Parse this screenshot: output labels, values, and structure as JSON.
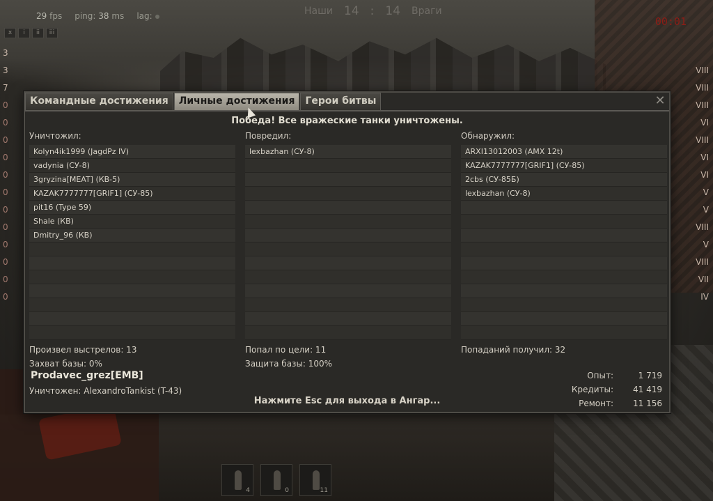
{
  "hud": {
    "fps_value": "29",
    "fps_label": "fps",
    "ping_label": "ping:",
    "ping_value": "38",
    "ping_unit": "ms",
    "lag_label": "lag:",
    "team_ours": "Наши",
    "team_ours_score": "14",
    "score_separator": ":",
    "team_enemy_score": "14",
    "team_enemy": "Враги",
    "timer": "00:01",
    "view_buttons": [
      "x",
      "i",
      "ii",
      "iii"
    ]
  },
  "team_left_rows": [
    "3",
    "3",
    "7",
    "0",
    "0",
    "0",
    "0",
    "0",
    "0",
    "0",
    "0",
    "0",
    "0",
    "0",
    "0"
  ],
  "team_right_rows": [
    "",
    "VIII",
    "VIII",
    "VIII",
    "VI",
    "VIII",
    "VI",
    "VI",
    "V",
    "V",
    "VIII",
    "V",
    "VIII",
    "VII",
    "IV"
  ],
  "ammo": [
    {
      "count": "4"
    },
    {
      "count": "0"
    },
    {
      "count": "11"
    }
  ],
  "dialog": {
    "tabs": [
      {
        "label": "Командные достижения",
        "active": false
      },
      {
        "label": "Личные достижения",
        "active": true
      },
      {
        "label": "Герои битвы",
        "active": false
      }
    ],
    "close_label": "✕",
    "headline": "Победа! Все вражеские танки уничтожены.",
    "columns": {
      "killed": {
        "title": "Уничтожил:",
        "items": [
          "Kolyn4ik1999 (JagdPz IV)",
          "vadynia (СУ-8)",
          "3gryzina[MEAT] (КВ-5)",
          "KAZAK7777777[GRIF1] (СУ-85)",
          "pit16 (Type 59)",
          "Shale (КВ)",
          "Dmitry_96 (КВ)",
          "",
          "",
          "",
          "",
          "",
          "",
          ""
        ]
      },
      "damaged": {
        "title": "Повредил:",
        "items": [
          "lexbazhan (СУ-8)",
          "",
          "",
          "",
          "",
          "",
          "",
          "",
          "",
          "",
          "",
          "",
          "",
          ""
        ]
      },
      "spotted": {
        "title": "Обнаружил:",
        "items": [
          "ARXI13012003 (AMX 12t)",
          "KAZAK7777777[GRIF1] (СУ-85)",
          "2cbs (СУ-85Б)",
          "lexbazhan (СУ-8)",
          "",
          "",
          "",
          "",
          "",
          "",
          "",
          "",
          "",
          ""
        ]
      }
    },
    "stats": {
      "shots": "Произвел выстрелов: 13",
      "hits": "Попал по цели: 11",
      "received": "Попаданий получил: 32",
      "capture": "Захват базы: 0%",
      "defense": "Защита базы: 100%",
      "destroyed_by": "Уничтожен: AlexandroTankist (T-43)"
    },
    "player_name": "Prodavec_grez[EMB]",
    "exit_message": "Нажмите Esc для выхода в Ангар...",
    "rewards": [
      {
        "label": "Опыт:",
        "value": "1 719"
      },
      {
        "label": "Кредиты:",
        "value": "41 419"
      },
      {
        "label": "Ремонт:",
        "value": "11 156"
      }
    ]
  }
}
